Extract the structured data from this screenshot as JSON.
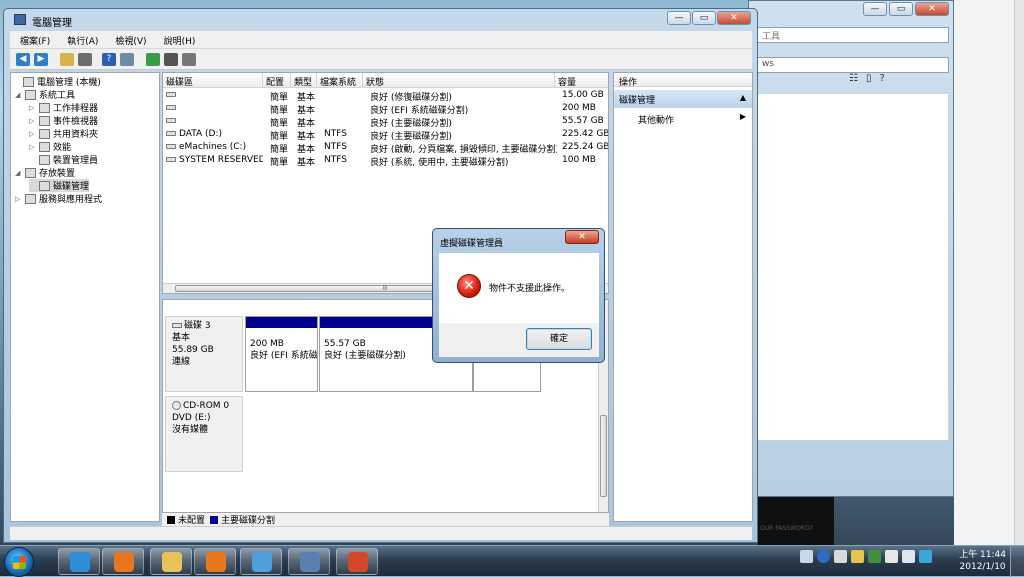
{
  "background_window": {
    "address_text": "工具",
    "search_text": "ws",
    "caption": {
      "minimize": "—",
      "maximize": "▭",
      "close": "✕"
    }
  },
  "dark_image_text": "OUR PASSWORD?",
  "window": {
    "title": "電腦管理",
    "caption": {
      "minimize": "—",
      "maximize": "▭",
      "close": "✕"
    }
  },
  "menu": [
    "檔案(F)",
    "執行(A)",
    "檢視(V)",
    "說明(H)"
  ],
  "tree": [
    {
      "label": "電腦管理 (本機)",
      "level": 0,
      "expander": ""
    },
    {
      "label": "系統工具",
      "level": 1,
      "expander": "◢"
    },
    {
      "label": "工作排程器",
      "level": 2,
      "expander": "▷"
    },
    {
      "label": "事件檢視器",
      "level": 2,
      "expander": "▷"
    },
    {
      "label": "共用資料夾",
      "level": 2,
      "expander": "▷"
    },
    {
      "label": "效能",
      "level": 2,
      "expander": "▷"
    },
    {
      "label": "裝置管理員",
      "level": 2,
      "expander": ""
    },
    {
      "label": "存放裝置",
      "level": 1,
      "expander": "◢"
    },
    {
      "label": "磁碟管理",
      "level": 2,
      "expander": "",
      "selected": true
    },
    {
      "label": "服務與應用程式",
      "level": 1,
      "expander": "▷"
    }
  ],
  "volumes": {
    "headers": [
      "磁碟區",
      "配置",
      "類型",
      "檔案系統",
      "狀態",
      "容量"
    ],
    "rows": [
      {
        "name": "",
        "layout": "簡單",
        "type": "基本",
        "fs": "",
        "status": "良好 (修復磁碟分割)",
        "capacity": "15.00 GB"
      },
      {
        "name": "",
        "layout": "簡單",
        "type": "基本",
        "fs": "",
        "status": "良好 (EFI 系統磁碟分割)",
        "capacity": "200 MB"
      },
      {
        "name": "",
        "layout": "簡單",
        "type": "基本",
        "fs": "",
        "status": "良好 (主要磁碟分割)",
        "capacity": "55.57 GB"
      },
      {
        "name": "DATA (D:)",
        "layout": "簡單",
        "type": "基本",
        "fs": "NTFS",
        "status": "良好 (主要磁碟分割)",
        "capacity": "225.42 GB"
      },
      {
        "name": "eMachines (C:)",
        "layout": "簡單",
        "type": "基本",
        "fs": "NTFS",
        "status": "良好 (啟動, 分頁檔案, 損毀傾印, 主要磁碟分割)",
        "capacity": "225.24 GB"
      },
      {
        "name": "SYSTEM RESERVED",
        "layout": "簡單",
        "type": "基本",
        "fs": "NTFS",
        "status": "良好 (系統, 使用中, 主要磁碟分割)",
        "capacity": "100 MB"
      }
    ],
    "scroll_grip": "III"
  },
  "disks": [
    {
      "name": "磁碟 3",
      "type": "基本",
      "size": "55.89 GB",
      "state": "連線",
      "partitions": [
        {
          "size": "200 MB",
          "status": "良好 (EFI 系統磁"
        },
        {
          "size": "55.57 GB",
          "status": "良好 (主要磁碟分割)"
        },
        {
          "size": "",
          "status": ""
        }
      ]
    },
    {
      "name": "CD-ROM 0",
      "type": "DVD (E:)",
      "size": "",
      "state": "沒有媒體",
      "partitions": []
    }
  ],
  "legend": [
    {
      "label": "未配置",
      "color": "#000000"
    },
    {
      "label": "主要磁碟分割",
      "color": "#01008f"
    }
  ],
  "actions": {
    "header": "操作",
    "section": "磁碟管理",
    "section_arrow": "▲",
    "item": "其他動作",
    "item_arrow": "▶"
  },
  "dialog": {
    "title": "虛擬磁碟管理員",
    "close": "✕",
    "icon": "✕",
    "message": "物件不支援此操作。",
    "ok": "確定"
  },
  "taskbar": {
    "time": "上午 11:44",
    "date": "2012/1/10",
    "apps": [
      {
        "name": "ie",
        "color": "#2a8fd8"
      },
      {
        "name": "firefox",
        "color": "#e8761d"
      },
      {
        "name": "explorer",
        "color": "#e8c35a"
      },
      {
        "name": "firefox-2",
        "color": "#e8761d"
      },
      {
        "name": "remote",
        "color": "#4f9fd8"
      },
      {
        "name": "computer-management",
        "color": "#5a7fb0"
      },
      {
        "name": "powerpoint",
        "color": "#d2492a"
      }
    ]
  },
  "colors": {
    "primary_partition": "#01008f",
    "unallocated": "#000000",
    "error_red": "#d41b0b"
  }
}
